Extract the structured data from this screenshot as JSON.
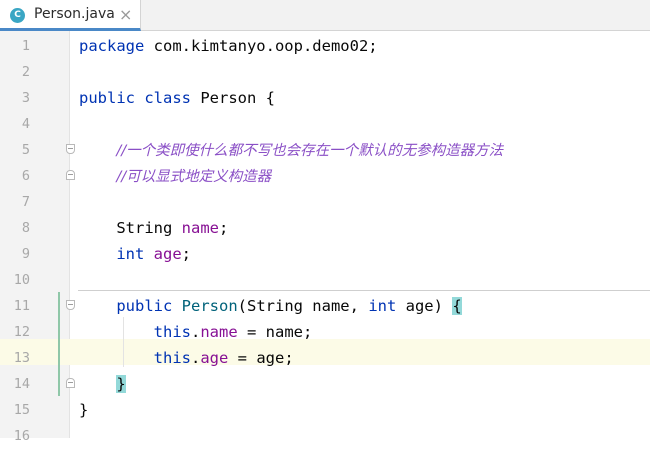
{
  "tab": {
    "icon_letter": "C",
    "filename": "Person.java",
    "close_glyph": "×"
  },
  "lines": [
    {
      "n": "1",
      "tokens": [
        {
          "t": "package ",
          "c": "kw"
        },
        {
          "t": "com.kimtanyo.oop.demo02;",
          "c": ""
        }
      ]
    },
    {
      "n": "2",
      "tokens": []
    },
    {
      "n": "3",
      "tokens": [
        {
          "t": "public ",
          "c": "kw"
        },
        {
          "t": "class ",
          "c": "kw"
        },
        {
          "t": "Person {",
          "c": ""
        }
      ]
    },
    {
      "n": "4",
      "tokens": []
    },
    {
      "n": "5",
      "fold": "open",
      "tokens": [
        {
          "t": "    ",
          "c": ""
        },
        {
          "t": "//一个类即使什么都不写也会存在一个默认的无参构造器方法",
          "c": "cmt"
        }
      ]
    },
    {
      "n": "6",
      "fold": "close",
      "tokens": [
        {
          "t": "    ",
          "c": ""
        },
        {
          "t": "//可以显式地定义构造器",
          "c": "cmt"
        }
      ]
    },
    {
      "n": "7",
      "tokens": []
    },
    {
      "n": "8",
      "tokens": [
        {
          "t": "    String ",
          "c": ""
        },
        {
          "t": "name",
          "c": "field"
        },
        {
          "t": ";",
          "c": ""
        }
      ]
    },
    {
      "n": "9",
      "tokens": [
        {
          "t": "    ",
          "c": ""
        },
        {
          "t": "int ",
          "c": "kw"
        },
        {
          "t": "age",
          "c": "field"
        },
        {
          "t": ";",
          "c": ""
        }
      ]
    },
    {
      "n": "10",
      "tokens": []
    },
    {
      "n": "11",
      "fold": "open",
      "tokens": [
        {
          "t": "    ",
          "c": ""
        },
        {
          "t": "public ",
          "c": "kw"
        },
        {
          "t": "Person",
          "c": "fn"
        },
        {
          "t": "(String name, ",
          "c": ""
        },
        {
          "t": "int ",
          "c": "kw"
        },
        {
          "t": "age) ",
          "c": ""
        },
        {
          "t": "{",
          "c": "brace-hl"
        }
      ]
    },
    {
      "n": "12",
      "tokens": [
        {
          "t": "        ",
          "c": ""
        },
        {
          "t": "this",
          "c": "kw"
        },
        {
          "t": ".",
          "c": ""
        },
        {
          "t": "name",
          "c": "field"
        },
        {
          "t": " = name;",
          "c": ""
        }
      ]
    },
    {
      "n": "13",
      "tokens": [
        {
          "t": "        ",
          "c": ""
        },
        {
          "t": "this",
          "c": "kw"
        },
        {
          "t": ".",
          "c": ""
        },
        {
          "t": "age",
          "c": "field"
        },
        {
          "t": " = age;",
          "c": ""
        }
      ]
    },
    {
      "n": "14",
      "fold": "close",
      "tokens": [
        {
          "t": "    ",
          "c": ""
        },
        {
          "t": "}",
          "c": "brace-hl"
        }
      ]
    },
    {
      "n": "15",
      "tokens": [
        {
          "t": "}",
          "c": ""
        }
      ]
    },
    {
      "n": "16",
      "tokens": []
    }
  ]
}
